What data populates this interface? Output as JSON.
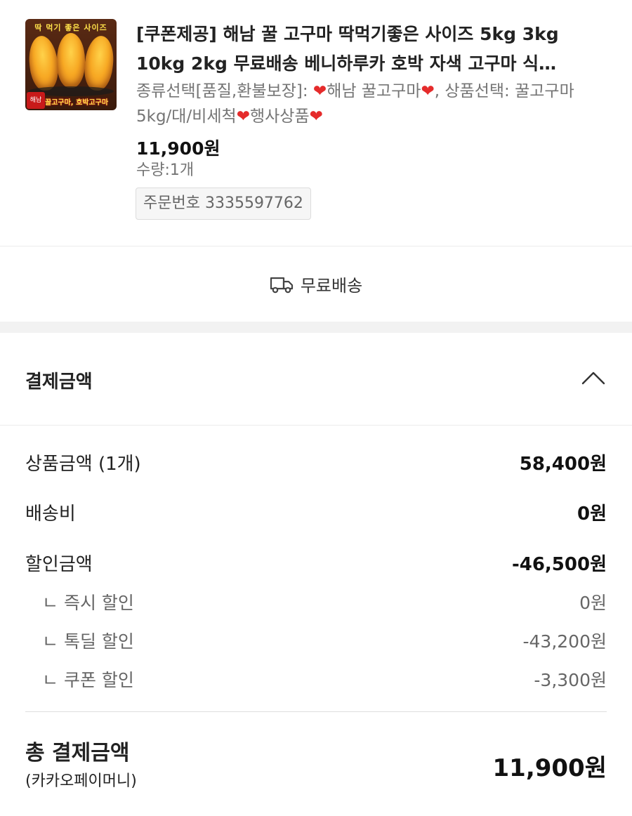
{
  "product": {
    "thumbnail": {
      "banner": "딱 먹기 좋은 사이즈",
      "caption": "꿀고구마, 호박고구마",
      "logo": "해남"
    },
    "title": "[쿠폰제공] 해남 꿀 고구마 딱먹기좋은 사이즈 5kg 3kg 10kg 2kg 무료배송 베니하루카 호박 자색 고구마 식…",
    "option": {
      "part1": "종류선택[품질,환불보장]: ",
      "part2": "해남 꿀고구마",
      "part3": ", 상품선택: 꿀고구마 5kg/대/비세척",
      "part4": "행사상품",
      "heart": "❤"
    },
    "price": "11,900원",
    "quantity": "수량:1개",
    "order_number": "주문번호 3335597762"
  },
  "shipping": {
    "icon": "truck-icon",
    "label": "무료배송"
  },
  "payment": {
    "title": "결제금액",
    "collapse_icon": "chevron-up-icon",
    "rows": [
      {
        "label": "상품금액 (1개)",
        "value": "58,400원"
      },
      {
        "label": "배송비",
        "value": "0원"
      },
      {
        "label": "할인금액",
        "value": "-46,500원"
      }
    ],
    "sub_rows": [
      {
        "label": "ㄴ 즉시 할인",
        "value": "0원"
      },
      {
        "label": "ㄴ 톡딜 할인",
        "value": "-43,200원"
      },
      {
        "label": "ㄴ 쿠폰 할인",
        "value": "-3,300원"
      }
    ],
    "total": {
      "label": "총 결제금액",
      "method": "(카카오페이머니)",
      "value": "11,900원"
    }
  },
  "colors": {
    "heart": "#e52b2b",
    "muted_text": "#757575",
    "section_gap": "#f2f2f2"
  }
}
